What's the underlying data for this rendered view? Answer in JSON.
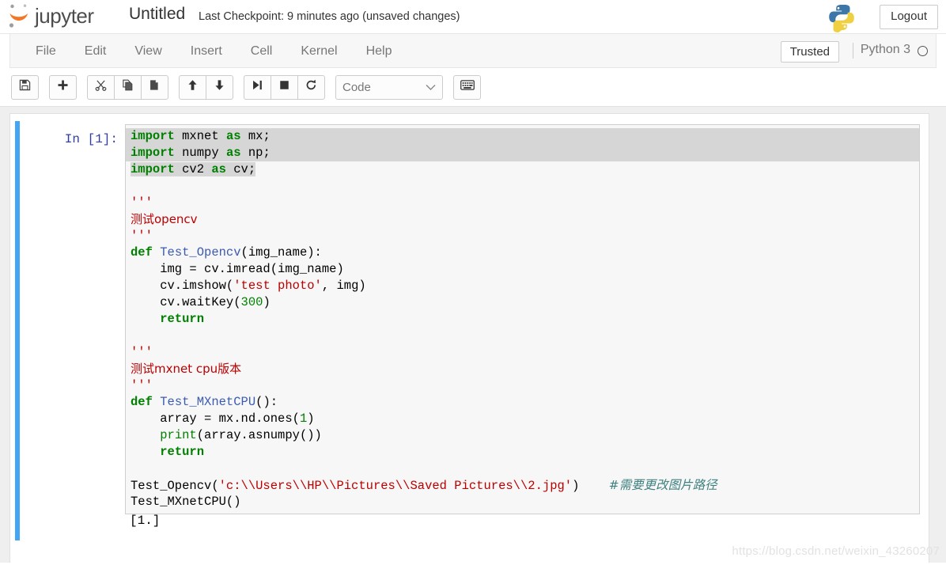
{
  "header": {
    "logo_text": "jupyter",
    "logo_icon": "jupyter-logo-icon",
    "notebook_name": "Untitled",
    "checkpoint": "Last Checkpoint: 9 minutes ago (unsaved changes)",
    "python_logo_icon": "python-logo-icon",
    "logout_label": "Logout"
  },
  "menubar": {
    "items": [
      {
        "label": "File"
      },
      {
        "label": "Edit"
      },
      {
        "label": "View"
      },
      {
        "label": "Insert"
      },
      {
        "label": "Cell"
      },
      {
        "label": "Kernel"
      },
      {
        "label": "Help"
      }
    ],
    "trusted_label": "Trusted",
    "kernel_name": "Python 3",
    "kernel_status_icon": "kernel-idle-circle-icon"
  },
  "toolbar": {
    "buttons": [
      {
        "name": "save-button",
        "icon": "floppy-disk-icon",
        "title": "Save and Checkpoint"
      },
      {
        "name": "insert-cell-button",
        "icon": "plus-icon",
        "title": "Insert cell below"
      },
      {
        "name": "cut-cell-button",
        "icon": "scissors-icon",
        "title": "Cut selected cells"
      },
      {
        "name": "copy-cell-button",
        "icon": "copy-icon",
        "title": "Copy selected cells"
      },
      {
        "name": "paste-cell-button",
        "icon": "paste-icon",
        "title": "Paste cells below"
      },
      {
        "name": "move-cell-up-button",
        "icon": "arrow-up-icon",
        "title": "Move selected cells up"
      },
      {
        "name": "move-cell-down-button",
        "icon": "arrow-down-icon",
        "title": "Move selected cells down"
      },
      {
        "name": "run-cell-button",
        "icon": "run-step-forward-icon",
        "title": "Run"
      },
      {
        "name": "interrupt-kernel-button",
        "icon": "stop-square-icon",
        "title": "Interrupt the kernel"
      },
      {
        "name": "restart-kernel-button",
        "icon": "restart-refresh-icon",
        "title": "Restart the kernel"
      }
    ],
    "celltype_value": "Code",
    "celltype_chevron_icon": "chevron-down-icon",
    "command_palette_icon": "keyboard-icon"
  },
  "notebook": {
    "cell": {
      "input_prompt": "In [1]:",
      "output_text": "[1.]",
      "code_lines": [
        "import mxnet as mx;",
        "import numpy as np;",
        "import cv2 as cv;",
        "",
        "'''",
        "测试opencv",
        "'''",
        "def Test_Opencv(img_name):",
        "    img = cv.imread(img_name)",
        "    cv.imshow('test photo', img)",
        "    cv.waitKey(300)",
        "    return",
        "",
        "'''",
        "测试mxnet cpu版本",
        "'''",
        "def Test_MXnetCPU():",
        "    array = mx.nd.ones(1)",
        "    print(array.asnumpy())",
        "    return",
        "",
        "Test_Opencv('c:\\\\Users\\\\HP\\\\Pictures\\\\Saved Pictures\\\\2.jpg')    #需要更改图片路径",
        "Test_MXnetCPU()"
      ]
    }
  },
  "watermark": "https://blog.csdn.net/weixin_43260207",
  "colors": {
    "accent_blue": "#42a5f5",
    "jupyter_orange": "#f37726",
    "keyword_green": "#008000",
    "string_red": "#bb0000",
    "function_blue": "#3c5bb0",
    "comment_teal": "#408080",
    "prompt_blue": "#303f9f"
  }
}
